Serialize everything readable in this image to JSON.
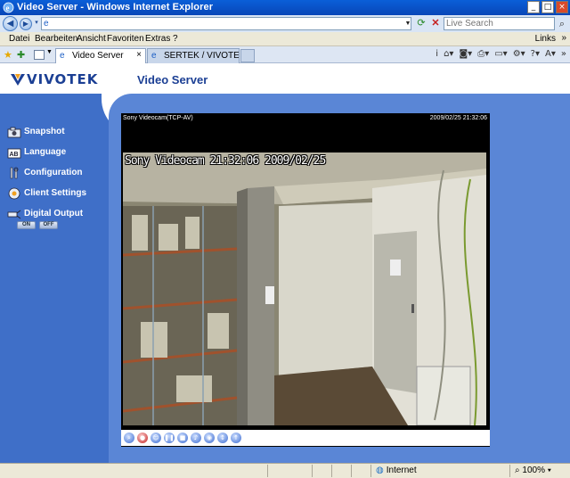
{
  "window": {
    "title": "Video Server - Windows Internet Explorer",
    "controls": [
      "_",
      "□",
      "×"
    ]
  },
  "address_bar": {
    "url": "",
    "search_placeholder": "Live Search"
  },
  "menu": {
    "items": [
      "Datei",
      "Bearbeiten",
      "Ansicht",
      "Favoriten",
      "Extras",
      "?"
    ],
    "links": "Links",
    "chevron": "»"
  },
  "tabs": [
    {
      "label": "Video Server",
      "active": true
    },
    {
      "label": "SERTEK / VIVOTEK LI...",
      "active": false
    }
  ],
  "page": {
    "brand": "VIVOTEK",
    "title": "Video Server",
    "sidebar": [
      {
        "label": "Snapshot",
        "icon": "camera-icon"
      },
      {
        "label": "Language",
        "icon": "language-icon"
      },
      {
        "label": "Configuration",
        "icon": "wrench-icon"
      },
      {
        "label": "Client Settings",
        "icon": "client-settings-icon"
      },
      {
        "label": "Digital Output",
        "icon": "digital-output-icon"
      }
    ],
    "digital_output": {
      "on": "ON",
      "off": "OFF"
    },
    "video": {
      "camera_name": "Sony Videocam(TCP-AV)",
      "timestamp": "2009/02/25 21:32:06",
      "osd_text": "Sony Videocam 21:32:06 2009/02/25"
    },
    "controls": [
      "zoom-icon",
      "record-icon",
      "users-icon",
      "pause-icon",
      "stop-icon",
      "volume-icon",
      "mic-icon",
      "talk-icon",
      "listen-icon"
    ]
  },
  "status": {
    "zone": "Internet",
    "zoom": "100%"
  },
  "colors": {
    "titlebar": "#0a5fd8",
    "page_bg": "#3f6fc8",
    "panel_bg": "#5a86d6",
    "brand": "#1b3f94"
  }
}
